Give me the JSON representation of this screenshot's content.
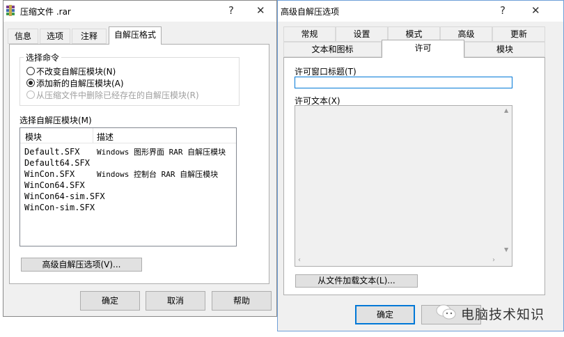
{
  "left_dialog": {
    "title": "压缩文件 .rar",
    "help_glyph": "?",
    "close_glyph": "✕",
    "tabs": [
      "信息",
      "选项",
      "注释",
      "自解压格式"
    ],
    "command_group": {
      "title": "选择命令",
      "options": [
        {
          "label": "不改变自解压模块(N)",
          "state": "unchecked"
        },
        {
          "label": "添加新的自解压模块(A)",
          "state": "checked"
        },
        {
          "label": "从压缩文件中删除已经存在的自解压模块(R)",
          "state": "disabled"
        }
      ]
    },
    "module_list": {
      "label": "选择自解压模块(M)",
      "headers": [
        "模块",
        "描述"
      ],
      "rows": [
        {
          "module": "Default.SFX",
          "desc": "Windows 图形界面 RAR 自解压模块"
        },
        {
          "module": "Default64.SFX",
          "desc": ""
        },
        {
          "module": "WinCon.SFX",
          "desc": "Windows 控制台 RAR 自解压模块"
        },
        {
          "module": "WinCon64.SFX",
          "desc": ""
        },
        {
          "module": "WinCon64-sim.SFX",
          "desc": ""
        },
        {
          "module": "WinCon-sim.SFX",
          "desc": ""
        }
      ]
    },
    "advanced_button": "高级自解压选项(V)...",
    "buttons": {
      "ok": "确定",
      "cancel": "取消",
      "help": "帮助"
    }
  },
  "right_dialog": {
    "title": "高级自解压选项",
    "help_glyph": "?",
    "close_glyph": "✕",
    "tabs_row1": [
      "常规",
      "设置",
      "模式",
      "高级",
      "更新"
    ],
    "tabs_row2": [
      "文本和图标",
      "许可",
      "模块"
    ],
    "license_title_label": "许可窗口标题(T)",
    "license_title_value": "",
    "license_text_label": "许可文本(X)",
    "load_button": "从文件加载文本(L)...",
    "buttons": {
      "ok": "确定",
      "cancel": ""
    }
  },
  "watermark": {
    "text": "电脑技术知识"
  },
  "colors": {
    "accent": "#0078d7",
    "dialog_bg": "#f0f0f0",
    "watermark_green": "#3fae49"
  }
}
